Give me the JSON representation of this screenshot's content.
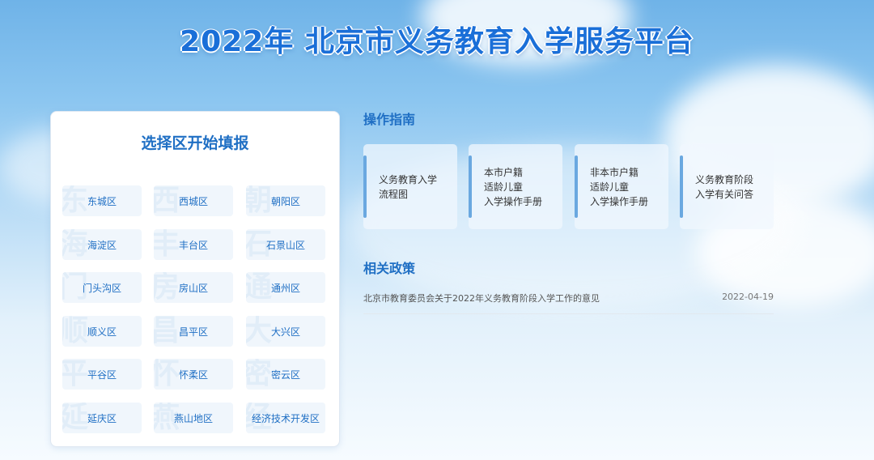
{
  "header": {
    "title": "2022年 北京市义务教育入学服务平台"
  },
  "district_panel": {
    "title": "选择区开始填报",
    "districts": [
      {
        "label": "东城区",
        "watermark": "东"
      },
      {
        "label": "西城区",
        "watermark": "西"
      },
      {
        "label": "朝阳区",
        "watermark": "朝"
      },
      {
        "label": "海淀区",
        "watermark": "海"
      },
      {
        "label": "丰台区",
        "watermark": "丰"
      },
      {
        "label": "石景山区",
        "watermark": "石"
      },
      {
        "label": "门头沟区",
        "watermark": "门"
      },
      {
        "label": "房山区",
        "watermark": "房"
      },
      {
        "label": "通州区",
        "watermark": "通"
      },
      {
        "label": "顺义区",
        "watermark": "顺"
      },
      {
        "label": "昌平区",
        "watermark": "昌"
      },
      {
        "label": "大兴区",
        "watermark": "大"
      },
      {
        "label": "平谷区",
        "watermark": "平"
      },
      {
        "label": "怀柔区",
        "watermark": "怀"
      },
      {
        "label": "密云区",
        "watermark": "密"
      },
      {
        "label": "延庆区",
        "watermark": "延"
      },
      {
        "label": "燕山地区",
        "watermark": "燕"
      },
      {
        "label": "经济技术开发区",
        "watermark": "经"
      }
    ]
  },
  "guide": {
    "title": "操作指南",
    "cards": [
      {
        "label": "义务教育入学\n流程图"
      },
      {
        "label": "本市户籍\n适龄儿童\n入学操作手册"
      },
      {
        "label": "非本市户籍\n适龄儿童\n入学操作手册"
      },
      {
        "label": "义务教育阶段\n入学有关问答"
      }
    ]
  },
  "policy": {
    "title": "相关政策",
    "items": [
      {
        "title": "北京市教育委员会关于2022年义务教育阶段入学工作的意见",
        "date": "2022-04-19"
      }
    ]
  },
  "colors": {
    "accent": "#1f6fc4",
    "title": "#1a6fd8",
    "card_bar": "#6aa8e0"
  }
}
